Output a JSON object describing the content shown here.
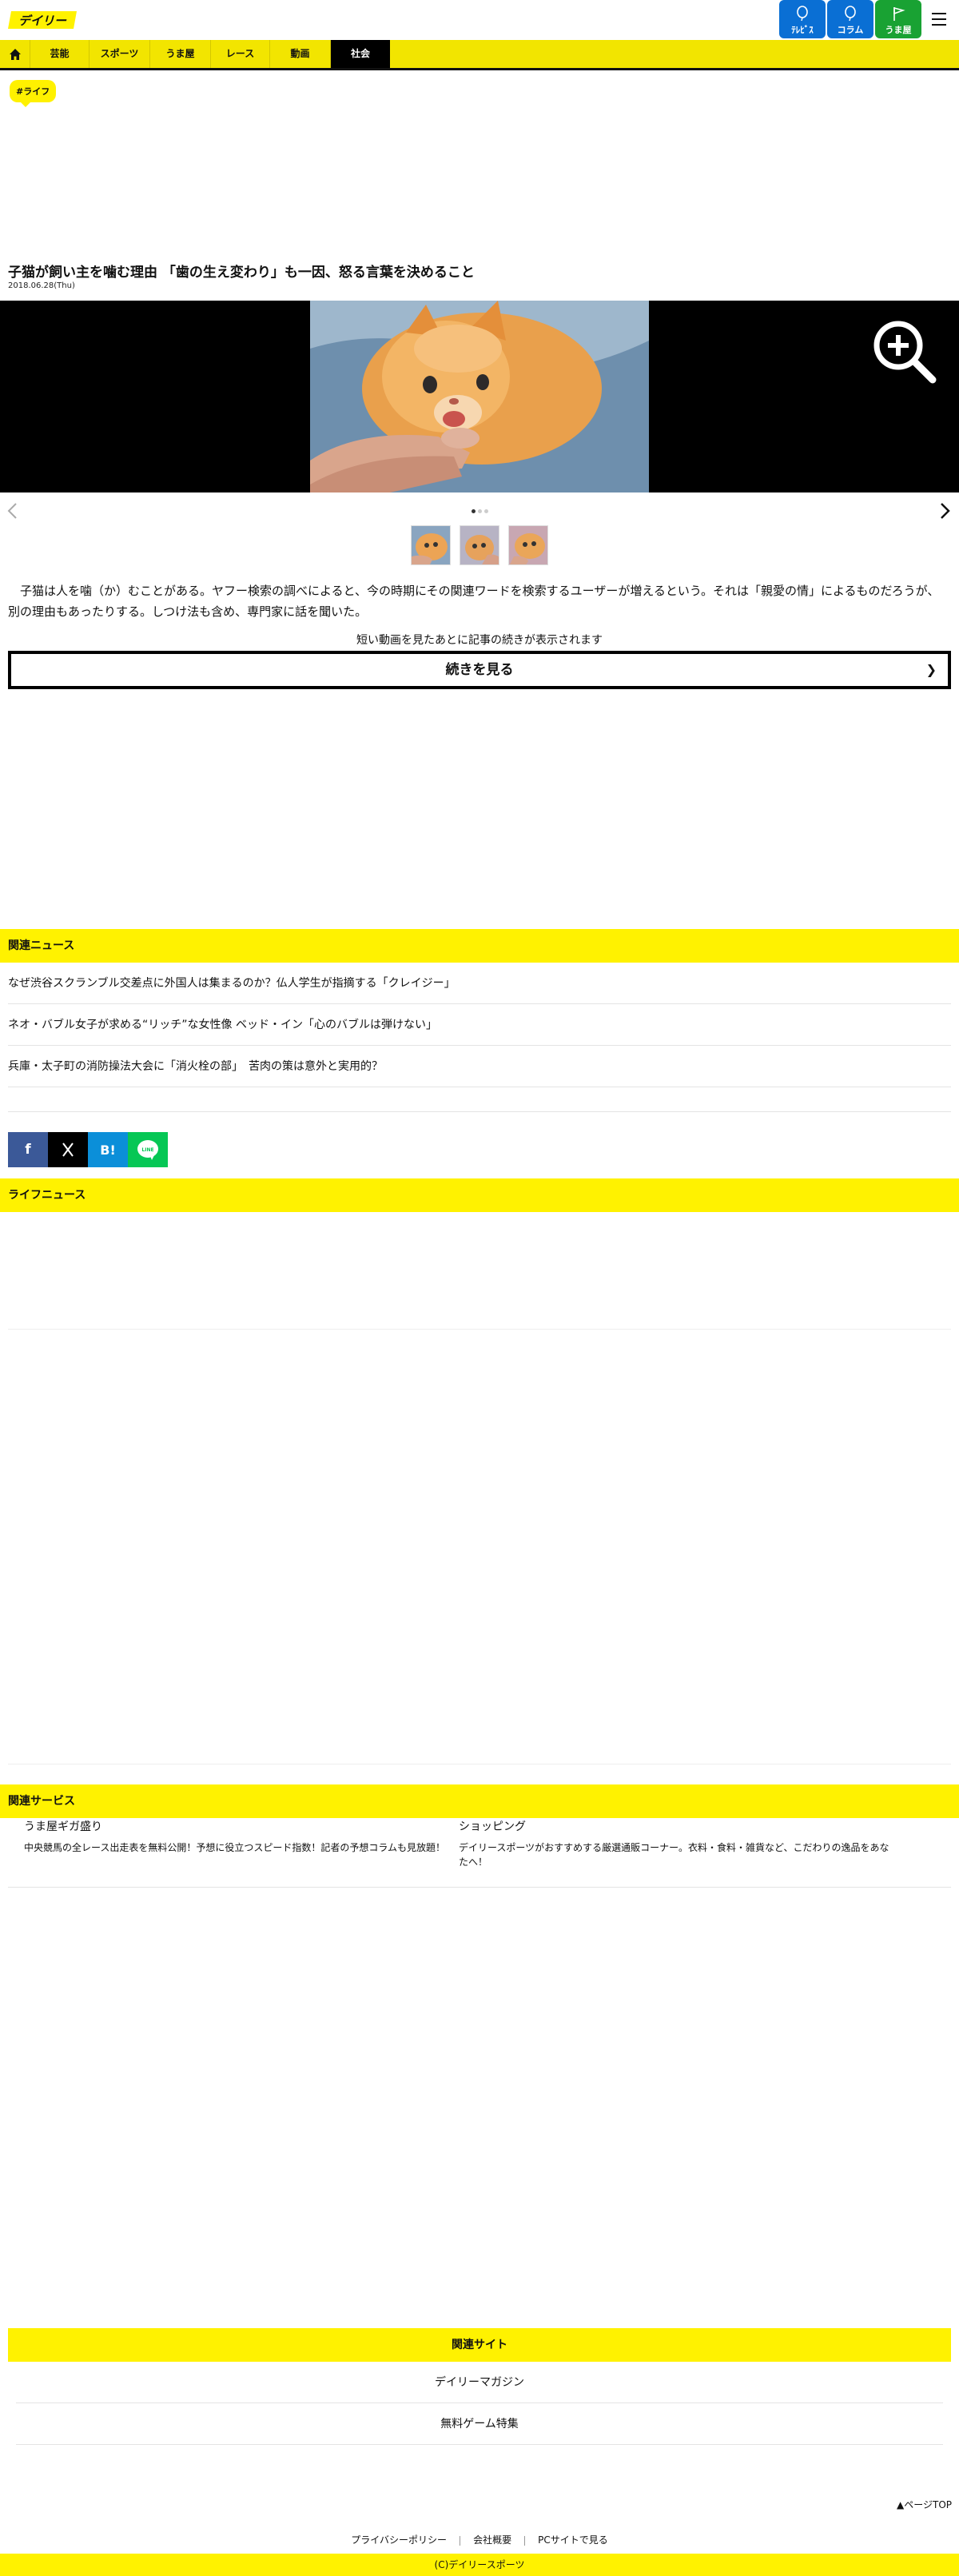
{
  "header": {
    "logo_text": "デイリー",
    "buttons": [
      {
        "label": "ﾃﾚﾋﾞｽ",
        "icon": "balloon-icon",
        "color": "#0a6fd4"
      },
      {
        "label": "コラム",
        "icon": "balloon-icon",
        "color": "#0a6fd4"
      },
      {
        "label": "うま屋",
        "icon": "flag-icon",
        "color": "#19a233"
      }
    ]
  },
  "nav": {
    "items": [
      "芸能",
      "スポーツ",
      "うま屋",
      "レース",
      "動画",
      "社会"
    ],
    "active": "社会"
  },
  "article": {
    "tag": "#ライフ",
    "title": "子猫が飼い主を噛む理由 「歯の生え変わり」も一因、怒る言葉を決めること",
    "date": "2018.06.28(Thu)",
    "lead": "子猫は人を噛（か）むことがある。ヤフー検索の調べによると、今の時期にその関連ワードを検索するユーザーが増えるという。それは「親愛の情」によるものだろうが、別の理由もあったりする。しつけ法も含め、専門家に話を聞いた。",
    "more_note": "短い動画を見たあとに記事の続きが表示されます",
    "more_button": "続きを見る"
  },
  "related_news": {
    "heading": "関連ニュース",
    "items": [
      "なぜ渋谷スクランブル交差点に外国人は集まるのか？仏人学生が指摘する「クレイジー」",
      "ネオ・バブル女子が求める“リッチ”な女性像 ベッド・イン「心のバブルは弾けない」",
      "兵庫・太子町の消防操法大会に「消火栓の部」　苦肉の策は意外と実用的？"
    ]
  },
  "share": [
    {
      "label": "f",
      "name": "facebook-share-button",
      "color": "#3b5998"
    },
    {
      "label": "𝕏",
      "name": "x-share-button",
      "color": "#000000"
    },
    {
      "label": "B!",
      "name": "hatena-share-button",
      "color": "#0b8fd9"
    },
    {
      "label": "LINE",
      "name": "line-share-button",
      "color": "#06c755"
    }
  ],
  "life_news": {
    "heading": "ライフニュース"
  },
  "services": {
    "heading": "関連サービス",
    "items": [
      {
        "name": "うま屋ギガ盛り",
        "desc": "中央競馬の全レース出走表を無料公開！予想に役立つスピード指数！記者の予想コラムも見放題！"
      },
      {
        "name": "ショッピング",
        "desc": "デイリースポーツがおすすめする厳選通販コーナー。衣料・食料・雑貨など、こだわりの逸品をあなたへ！"
      }
    ]
  },
  "sites": {
    "heading": "関連サイト",
    "items": [
      "デイリーマガジン",
      "無料ゲーム特集"
    ]
  },
  "footer": {
    "pagetop": "▲ページTOP",
    "links": [
      "プライバシーポリシー",
      "会社概要",
      "PCサイトで見る"
    ],
    "copyright": "(C)デイリースポーツ"
  }
}
